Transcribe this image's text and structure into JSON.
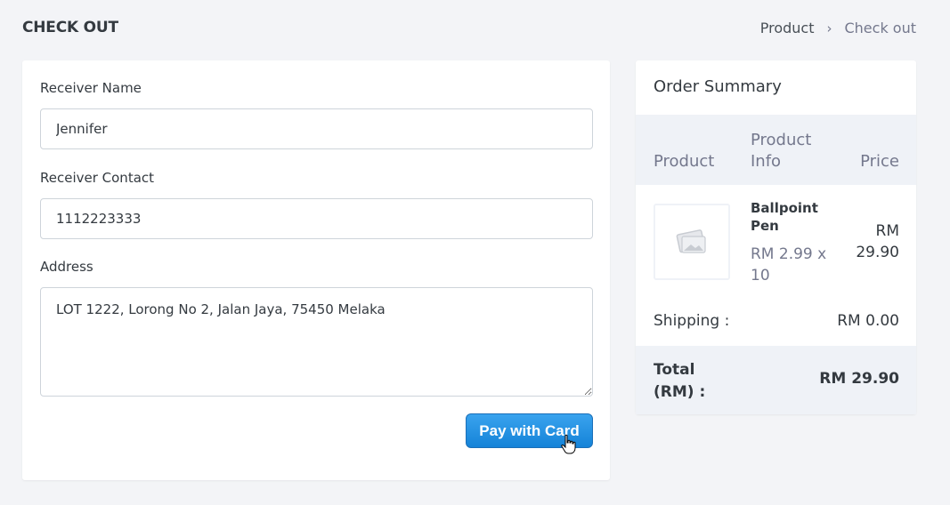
{
  "header": {
    "title": "CHECK OUT",
    "breadcrumb": [
      "Product",
      "Check out"
    ],
    "breadcrumb_separator": "›"
  },
  "form": {
    "receiver_name_label": "Receiver Name",
    "receiver_name_value": "Jennifer",
    "receiver_contact_label": "Receiver Contact",
    "receiver_contact_value": "1112223333",
    "address_label": "Address",
    "address_value": "LOT 1222, Lorong No 2, Jalan Jaya, 75450 Melaka",
    "pay_button_label": "Pay with Card"
  },
  "summary": {
    "title": "Order Summary",
    "columns": [
      "Product",
      "Product Info",
      "Price"
    ],
    "items": [
      {
        "image_icon": "image-placeholder-icon",
        "name": "Ballpoint Pen",
        "info": "RM 2.99 x 10",
        "price": "RM 29.90"
      }
    ],
    "shipping_label": "Shipping :",
    "shipping_value": "RM 0.00",
    "total_label": "Total (RM) :",
    "total_value": "RM 29.90"
  },
  "colors": {
    "accent_button": "#1583d8",
    "table_header_bg": "#eff2f7",
    "page_bg": "#f3f4f7"
  }
}
